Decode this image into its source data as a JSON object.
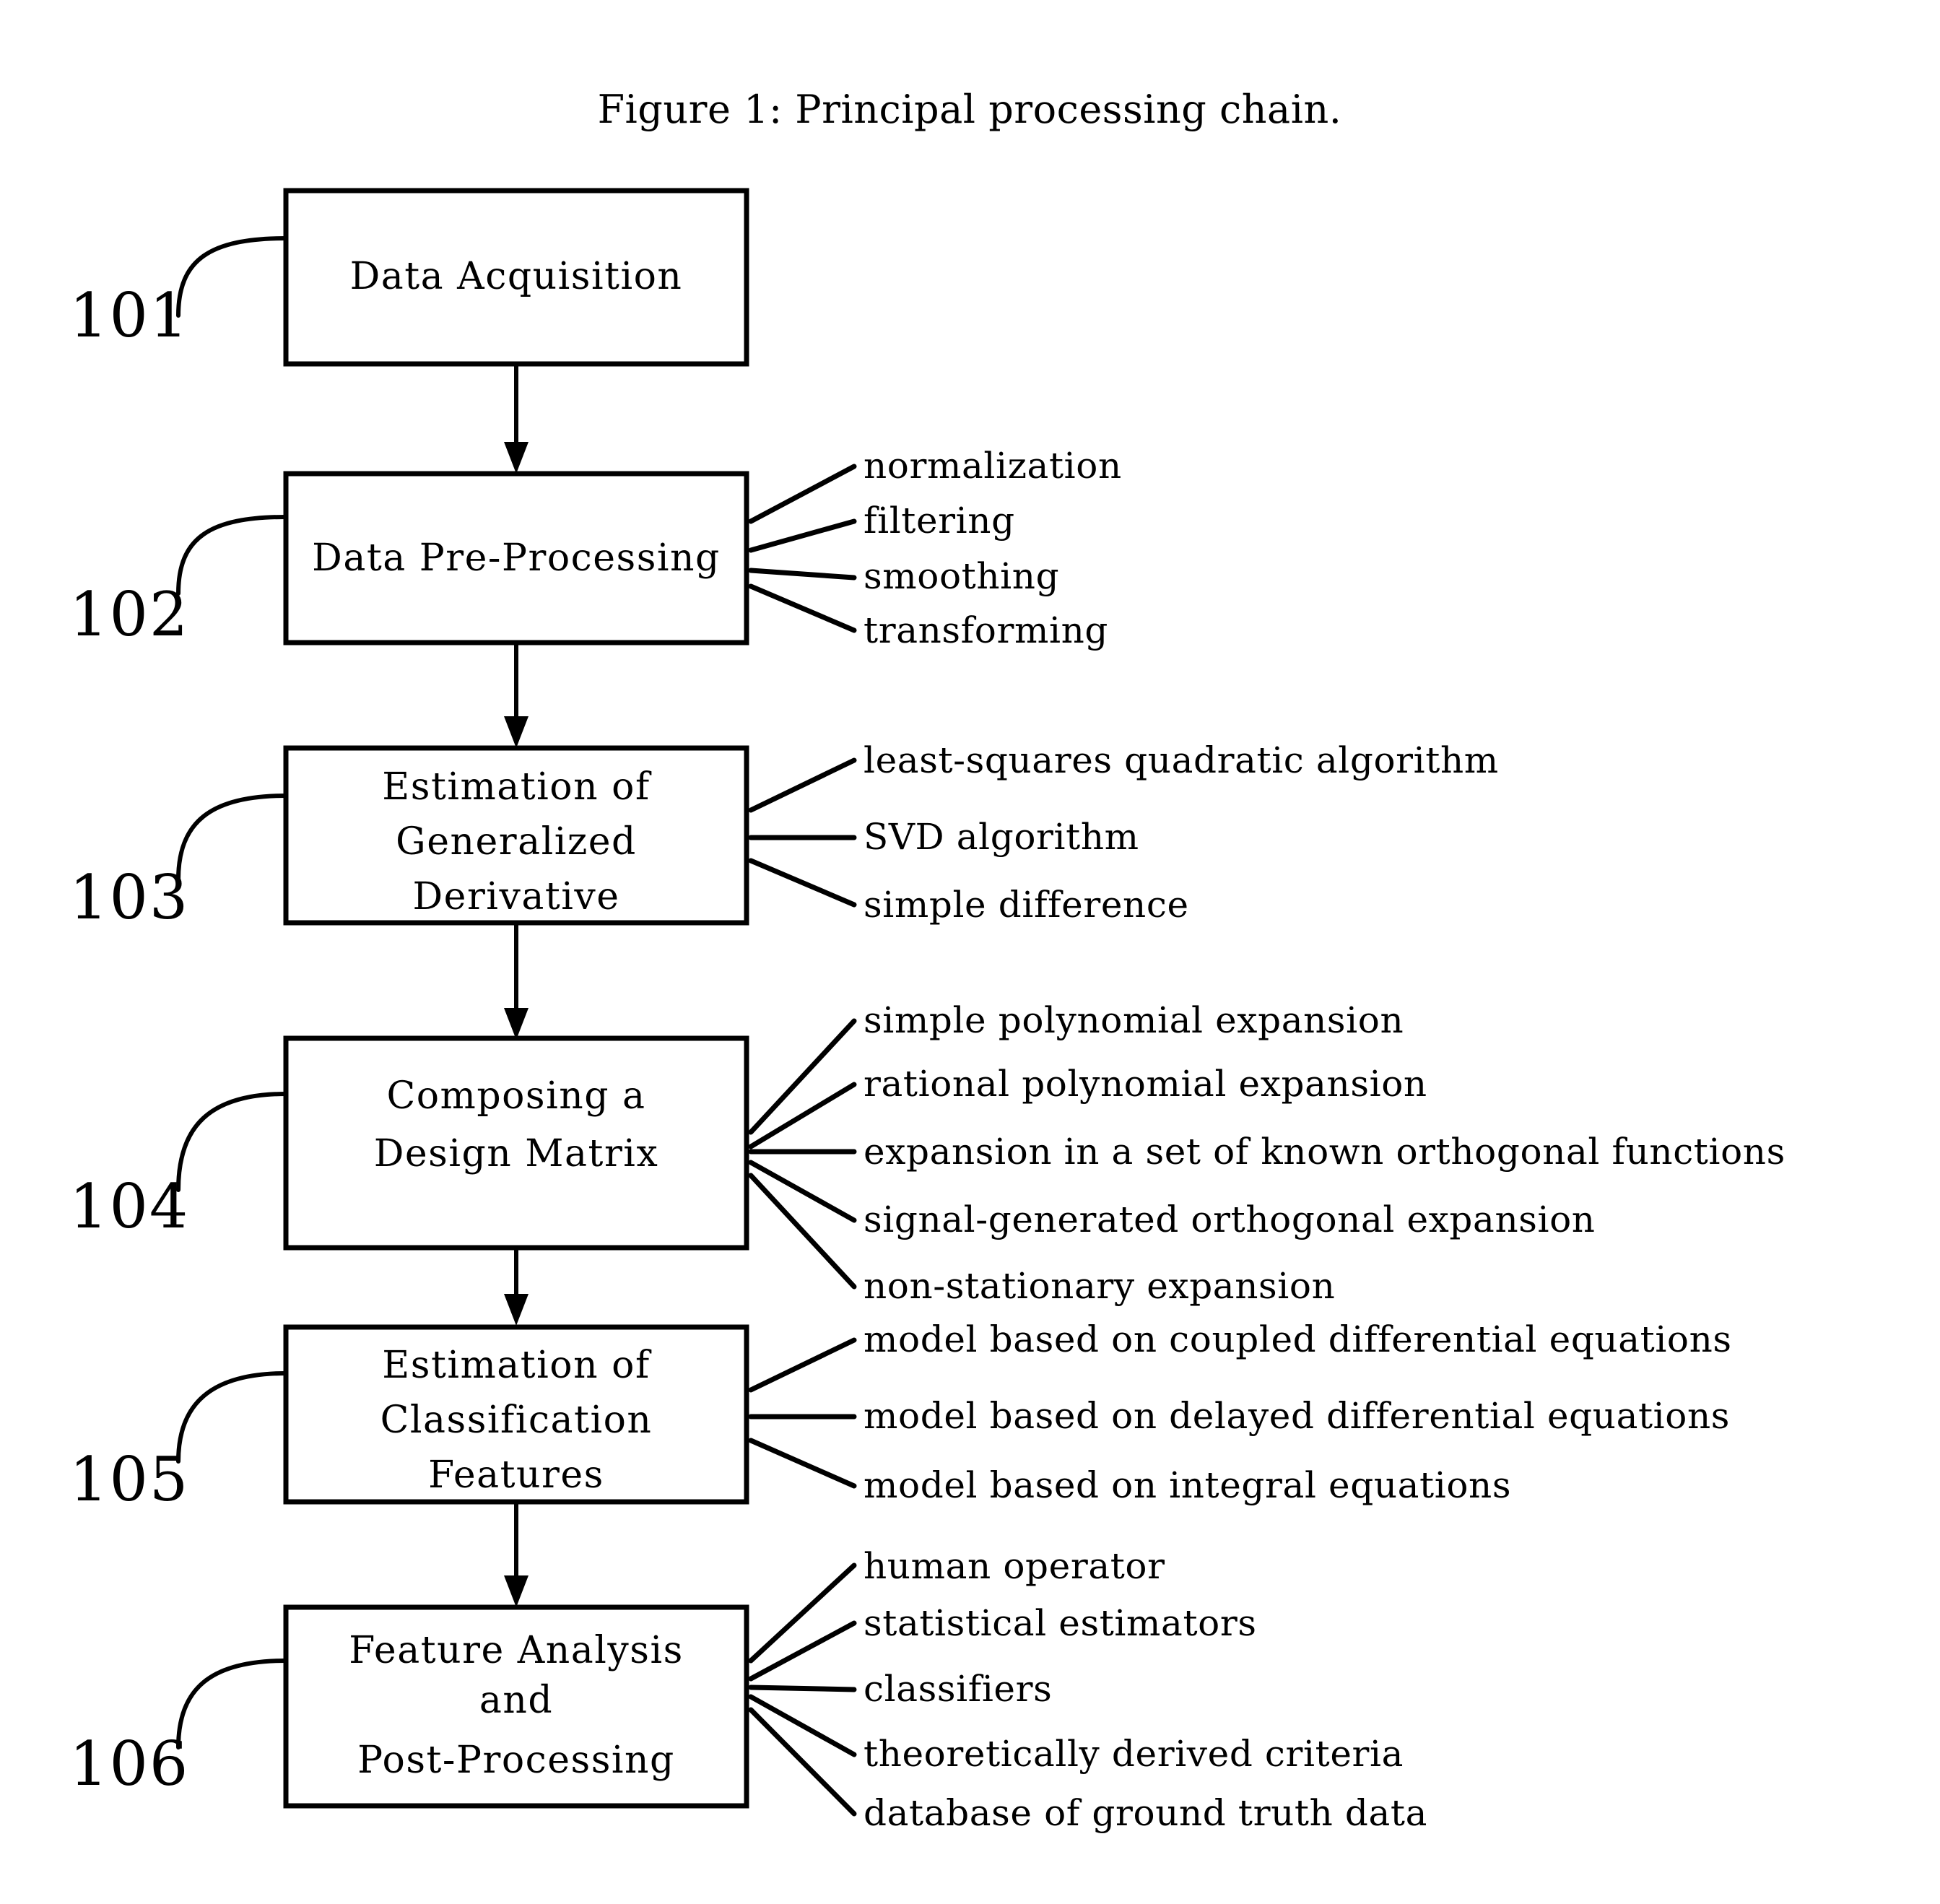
{
  "figure": {
    "title": "Figure 1: Principal processing chain.",
    "background_color": "#ffffff",
    "ink_color": "#000000"
  },
  "steps": [
    {
      "ref": "101",
      "lines": [
        "Data Acquisition"
      ],
      "branches": []
    },
    {
      "ref": "102",
      "lines": [
        "Data Pre-Processing"
      ],
      "branches": [
        "normalization",
        "filtering",
        "smoothing",
        "transforming"
      ]
    },
    {
      "ref": "103",
      "lines": [
        "Estimation of",
        "Generalized",
        "Derivative"
      ],
      "branches": [
        "least-squares quadratic algorithm",
        "SVD algorithm",
        "simple difference"
      ]
    },
    {
      "ref": "104",
      "lines": [
        "Composing a",
        "Design Matrix"
      ],
      "branches": [
        "simple polynomial expansion",
        "rational polynomial expansion",
        "expansion in a set of known orthogonal functions",
        "signal-generated orthogonal expansion",
        "non-stationary expansion"
      ]
    },
    {
      "ref": "105",
      "lines": [
        "Estimation of",
        "Classification",
        "Features"
      ],
      "branches": [
        "model based on coupled differential equations",
        "model based on delayed differential equations",
        "model based on integral equations"
      ]
    },
    {
      "ref": "106",
      "lines": [
        "Feature Analysis",
        "and",
        "Post-Processing"
      ],
      "branches": [
        "human operator",
        "statistical estimators",
        "classifiers",
        "theoretically derived criteria",
        "database of ground truth data"
      ]
    }
  ]
}
